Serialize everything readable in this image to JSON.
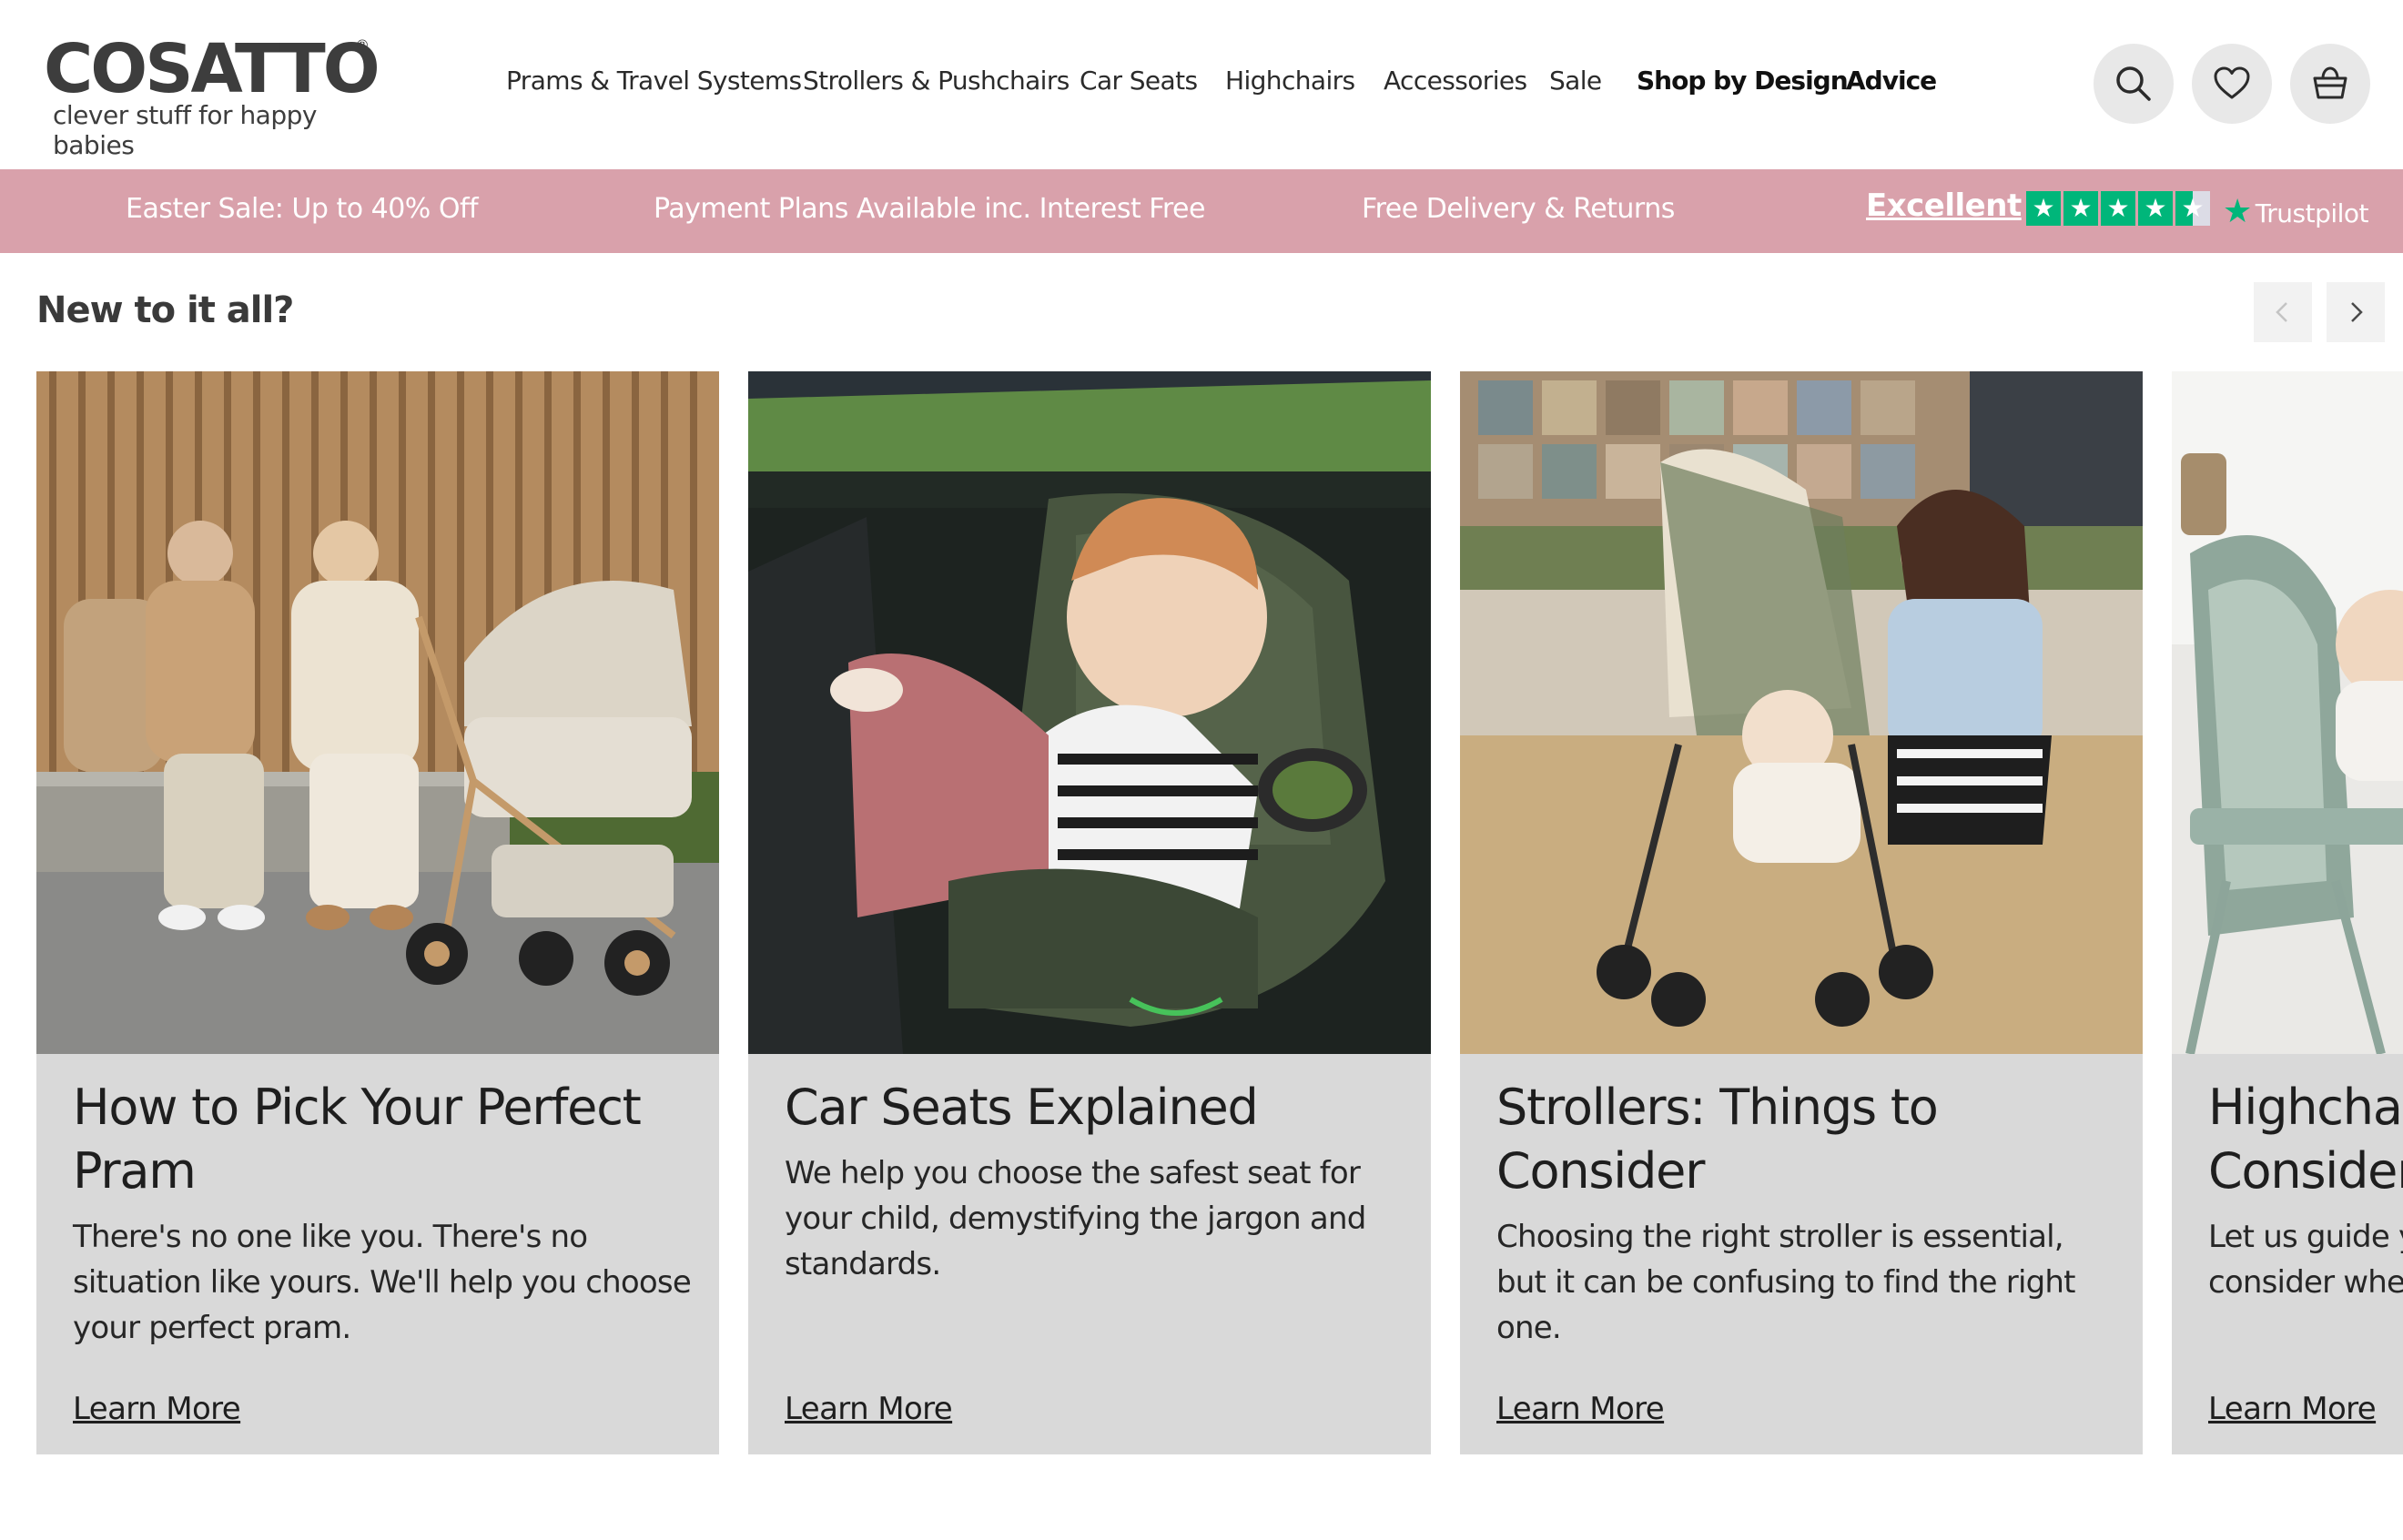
{
  "header": {
    "logo_text": "COSATTO",
    "logo_reg": "®",
    "tagline": "clever stuff for happy babies",
    "nav": [
      {
        "label": "Prams & Travel Systems",
        "bold": false
      },
      {
        "label": "Strollers & Pushchairs",
        "bold": false
      },
      {
        "label": "Car Seats",
        "bold": false
      },
      {
        "label": "Highchairs",
        "bold": false
      },
      {
        "label": "Accessories",
        "bold": false
      },
      {
        "label": "Sale",
        "bold": false
      },
      {
        "label": "Shop by Design",
        "bold": true
      },
      {
        "label": "Advice",
        "bold": true
      }
    ],
    "icons": [
      "search-icon",
      "heart-icon",
      "basket-icon"
    ]
  },
  "promo": {
    "items": [
      "Easter Sale: Up to 40% Off",
      "Payment Plans Available inc. Interest Free",
      "Free Delivery & Returns"
    ],
    "trustpilot": {
      "rating_label": "Excellent",
      "stars": 4.5,
      "brand": "Trustpilot"
    }
  },
  "section": {
    "title": "New to it all?"
  },
  "cards": [
    {
      "title": "How to Pick Your Perfect Pram",
      "description": "There's no one like you. There's no situation like yours. We'll help you choose your perfect pram.",
      "link": "Learn More"
    },
    {
      "title": "Car Seats Explained",
      "description": "We help you choose the safest seat for your child, demystifying the jargon and standards.",
      "link": "Learn More"
    },
    {
      "title": "Strollers: Things to Consider",
      "description": "Choosing the right stroller is essential, but it can be confusing to find the right one.",
      "link": "Learn More"
    },
    {
      "title": "Highchairs: Things to Consider",
      "description": "Let us guide you through what to consider when choosing a highchair.",
      "link": "Learn More"
    }
  ],
  "colors": {
    "promo_bar": "#d9a1ab",
    "card_bg": "#d9d9d9",
    "icon_bg": "#e8e8e8",
    "trustpilot_green": "#00b67a"
  }
}
